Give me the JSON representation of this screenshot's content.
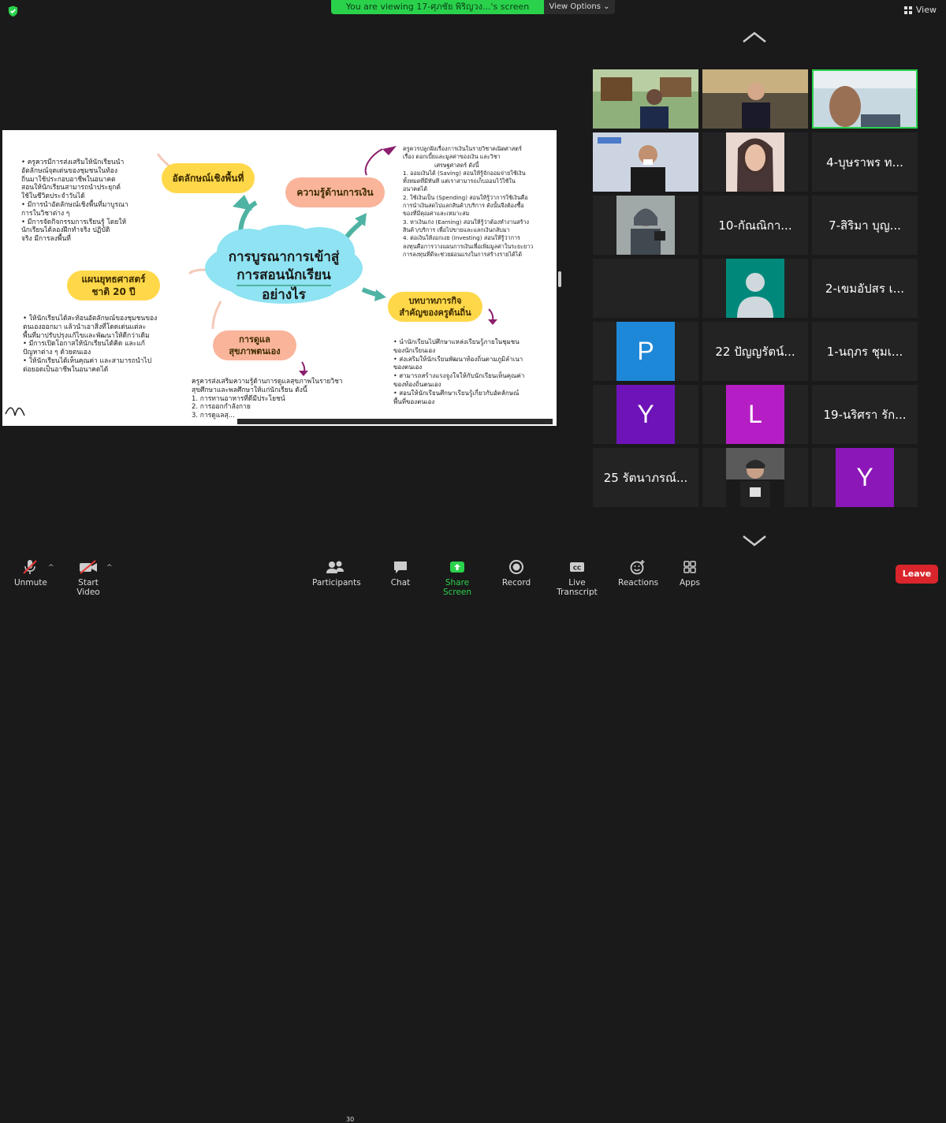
{
  "banner": {
    "text": "You are viewing 17-ศุภชัย พิริญวง...'s screen",
    "view_options": "View Options"
  },
  "view_button": "View",
  "slide": {
    "center_title": "การบูรณาการเข้าสู่การสอนนักเรียนอย่างไร",
    "center_lines": [
      "การบูรณาการเข้าสู่",
      "การสอนนักเรียน",
      "อย่างไร"
    ],
    "bubbles": {
      "identity": "อัตลักษณ์เชิงพื้นที่",
      "finance": "ความรู้ด้านการเงิน",
      "plan": "แผนยุทธศาสตร์ชาติ 20 ปี",
      "health": "การดูแลสุขภาพตนเอง",
      "role": "บทบาทภารกิจสำคัญของครูต้นถิ่น"
    },
    "identity_text": [
      "• ครูควรมีการส่งเสริมให้นักเรียนนำ",
      "  อัตลักษณ์จุดเด่นของชุมชนในท้อง",
      "  ถิ่นมาใช้ประกอบอาชีพในอนาคต",
      "  สอนให้นักเรียนสามารถนำประยุกต์",
      "  ใช้ในชีวิตประจำวันได้",
      "• มีการนำอัตลักษณ์เชิงพื้นที่มาบูรณา",
      "  การในวิชาต่าง ๆ",
      "• มีการจัดกิจกรรมการเรียนรู้ โดยให้",
      "  นักเรียนได้ลองฝึกทำจริง ปฏิบัติ",
      "  จริง มีการลงพื้นที่"
    ],
    "finance_text": [
      "ครูควรปลูกฝังเรื่องการเงินในรายวิชาคณิตศาสตร์",
      "เรื่อง ดอกเบี้ยและมูลค่าของเงิน และวิชา",
      "เศรษฐศาสตร์ ดังนี้",
      "1. ออมเงินได้ (Saving) สอนให้รู้จักออมจ่ายใช้เงิน",
      "   ทั้งหมดที่มีทันที แต่เราสามารถเก็บออมไว้ใช้ใน",
      "   อนาคตได้",
      "2. ใช้เงินเป็น (Spending) สอนให้รู้ว่าการใช้เงินคือ",
      "   การนำเงินสดไปแลกสินค้า/บริการ ดังนั้นจึงต้องซื้อ",
      "   ของที่มีคุณค่าและเหมาะสม",
      "3. หาเงินเก่ง (Earning) สอนให้รู้ว่าต้องทำงานสร้าง",
      "   สินค้า/บริการ เพื่อไปขายและแลกเงินกลับมา",
      "4. ต่อเงินให้งอกเงย (Investing) สอนให้รู้ว่าการ",
      "   ลงทุนคือการวางแผนการเงินเพื่อเพิ่มมูลค่าในระยะยาว",
      "   การลงทุนที่ดีจะช่วยผ่อนแรงในการสร้างรายได้ได้"
    ],
    "plan_text": [
      "• ให้นักเรียนได้สะท้อนอัตลักษณ์ของชุมชนของ",
      "  ตนเองออกมา แล้วนำเอาสิ่งที่โดดเด่นแต่ละ",
      "  พื้นที่มาปรับปรุงแก้ไขและพัฒนาให้ดีกว่าเดิม",
      "• มีการเปิดโอกาสให้นักเรียนได้คิด และแก้",
      "  ปัญหาต่าง ๆ ด้วยตนเอง",
      "• ให้นักเรียนได้เห็นคุณค่า และสามารถนำไป",
      "  ต่อยอดเป็นอาชีพในอนาคตได้"
    ],
    "health_text": [
      "ครูควรส่งเสริมความรู้ด้านการดูแลสุขภาพในรายวิชา",
      "สุขศึกษาและพลศึกษาให้แก่นักเรียน ดังนี้",
      "  1. การทานอาหารที่ดีมีประโยชน์",
      "  2. การออกกำลังกาย",
      "  3. การดูแลสุ..."
    ],
    "role_text": [
      "• นำนักเรียนไปศึกษาแหล่งเรียนรู้ภายในชุมชน",
      "  ของนักเรียนเอง",
      "• ส่งเสริมให้นักเรียนพัฒนาท้องถิ่นตามภูมิลำเนา",
      "  ของตนเอง",
      "• สามารถสร้างแรงจูงใจให้กับนักเรียนเห็นคุณค่า",
      "  ของท้องถิ่นตนเอง",
      "• สอนให้นักเรียนศึกษาเรียนรู้เกี่ยวกับอัตลักษณ์",
      "  พื้นที่ของตนเอง"
    ]
  },
  "participants": [
    {
      "label": "video-1",
      "type": "video"
    },
    {
      "label": "video-2",
      "type": "video"
    },
    {
      "label": "video-3",
      "type": "video",
      "active": true
    },
    {
      "label": "video-4",
      "type": "video"
    },
    {
      "label": "video-5",
      "type": "video"
    },
    {
      "name": "4-บุษราพร ท...",
      "type": "name"
    },
    {
      "label": "video-7",
      "type": "video"
    },
    {
      "name": "10-กัณณิกา...",
      "type": "name"
    },
    {
      "name": "7-สิริมา บุญ...",
      "type": "name"
    },
    {
      "label": "blank",
      "type": "blank"
    },
    {
      "label": "avatar",
      "type": "avatar",
      "color": "#00897b"
    },
    {
      "name": "2-เขมอัปสร เ...",
      "type": "name"
    },
    {
      "letter": "P",
      "type": "letter",
      "color": "#1e88d8"
    },
    {
      "name": "22 ปัญญรัตน์...",
      "type": "name"
    },
    {
      "name": "1-นฤภร ชุมเ...",
      "type": "name"
    },
    {
      "letter": "Y",
      "type": "letter",
      "color": "#6d13b8"
    },
    {
      "letter": "L",
      "type": "letter",
      "color": "#b51ec5"
    },
    {
      "name": "19-นริศรา รัก...",
      "type": "name"
    },
    {
      "name": "25 รัตนาภรณ์...",
      "type": "name"
    },
    {
      "label": "video-20",
      "type": "video"
    },
    {
      "letter": "Y",
      "type": "letter",
      "color": "#8b17b8"
    }
  ],
  "toolbar": {
    "unmute": "Unmute",
    "start_video": "Start Video",
    "participants": "Participants",
    "participant_count": "30",
    "chat": "Chat",
    "share_screen": "Share Screen",
    "record": "Record",
    "live_transcript": "Live Transcript",
    "reactions": "Reactions",
    "apps": "Apps",
    "leave": "Leave"
  },
  "colors": {
    "accent_green": "#2ad24c",
    "leave_red": "#d9252b",
    "bubble_yellow": "#ffd84a",
    "bubble_peach": "#f9b49a",
    "cloud_blue": "#8fe3f2"
  }
}
